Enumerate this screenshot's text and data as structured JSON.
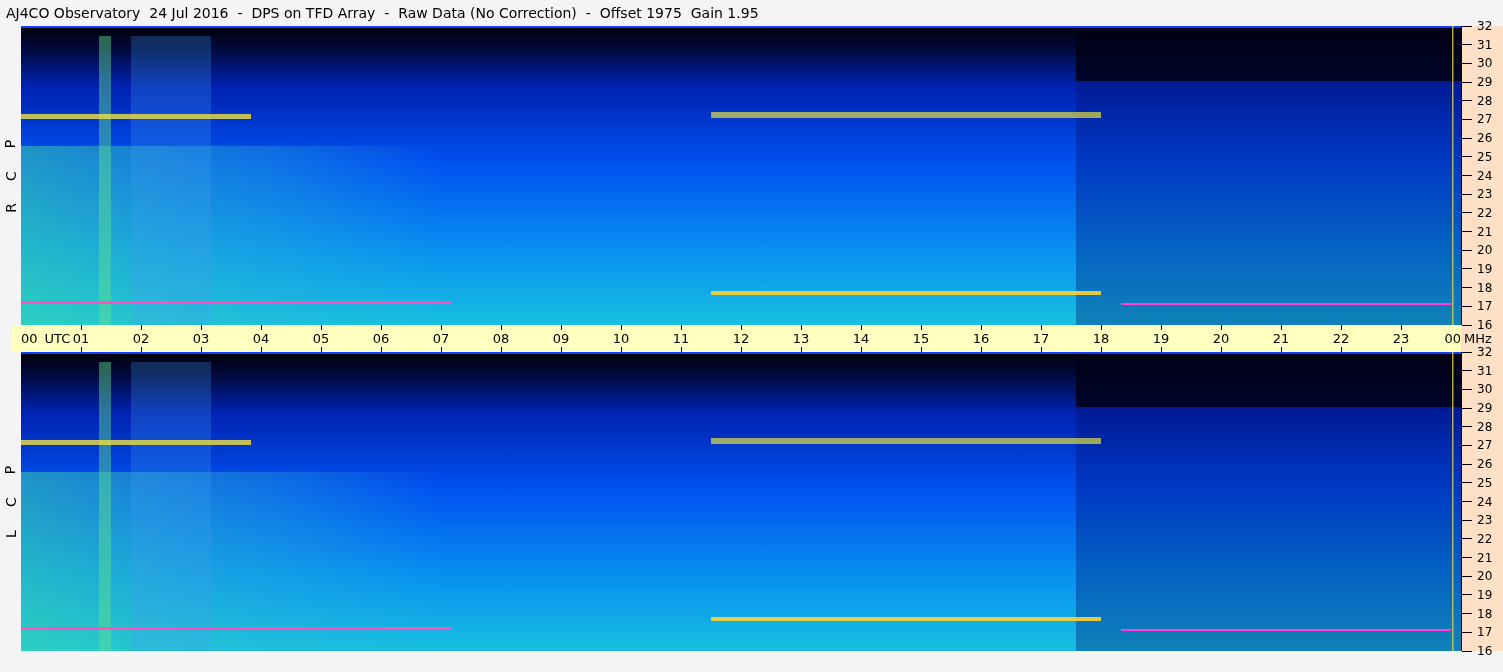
{
  "title": "AJ4CO Observatory  24 Jul 2016  -  DPS on TFD Array  -  Raw Data (No Correction)  -  Offset 1975  Gain 1.95",
  "panels": [
    {
      "polarization": [
        "R",
        "C",
        "P"
      ],
      "frequency_ticks": [
        "32",
        "31",
        "30",
        "29",
        "28",
        "27",
        "26",
        "25",
        "24",
        "23",
        "22",
        "21",
        "20",
        "19",
        "18",
        "17",
        "16"
      ]
    },
    {
      "polarization": [
        "L",
        "C",
        "P"
      ],
      "frequency_ticks": [
        "32",
        "31",
        "30",
        "29",
        "28",
        "27",
        "26",
        "25",
        "24",
        "23",
        "22",
        "21",
        "20",
        "19",
        "18",
        "17",
        "16"
      ]
    }
  ],
  "time_axis": {
    "start": "00",
    "zone": "UTC",
    "hours": [
      "01",
      "02",
      "03",
      "04",
      "05",
      "06",
      "07",
      "08",
      "09",
      "10",
      "11",
      "12",
      "13",
      "14",
      "15",
      "16",
      "17",
      "18",
      "19",
      "20",
      "21",
      "22",
      "23"
    ],
    "end": "00",
    "unit": "MHz"
  }
}
